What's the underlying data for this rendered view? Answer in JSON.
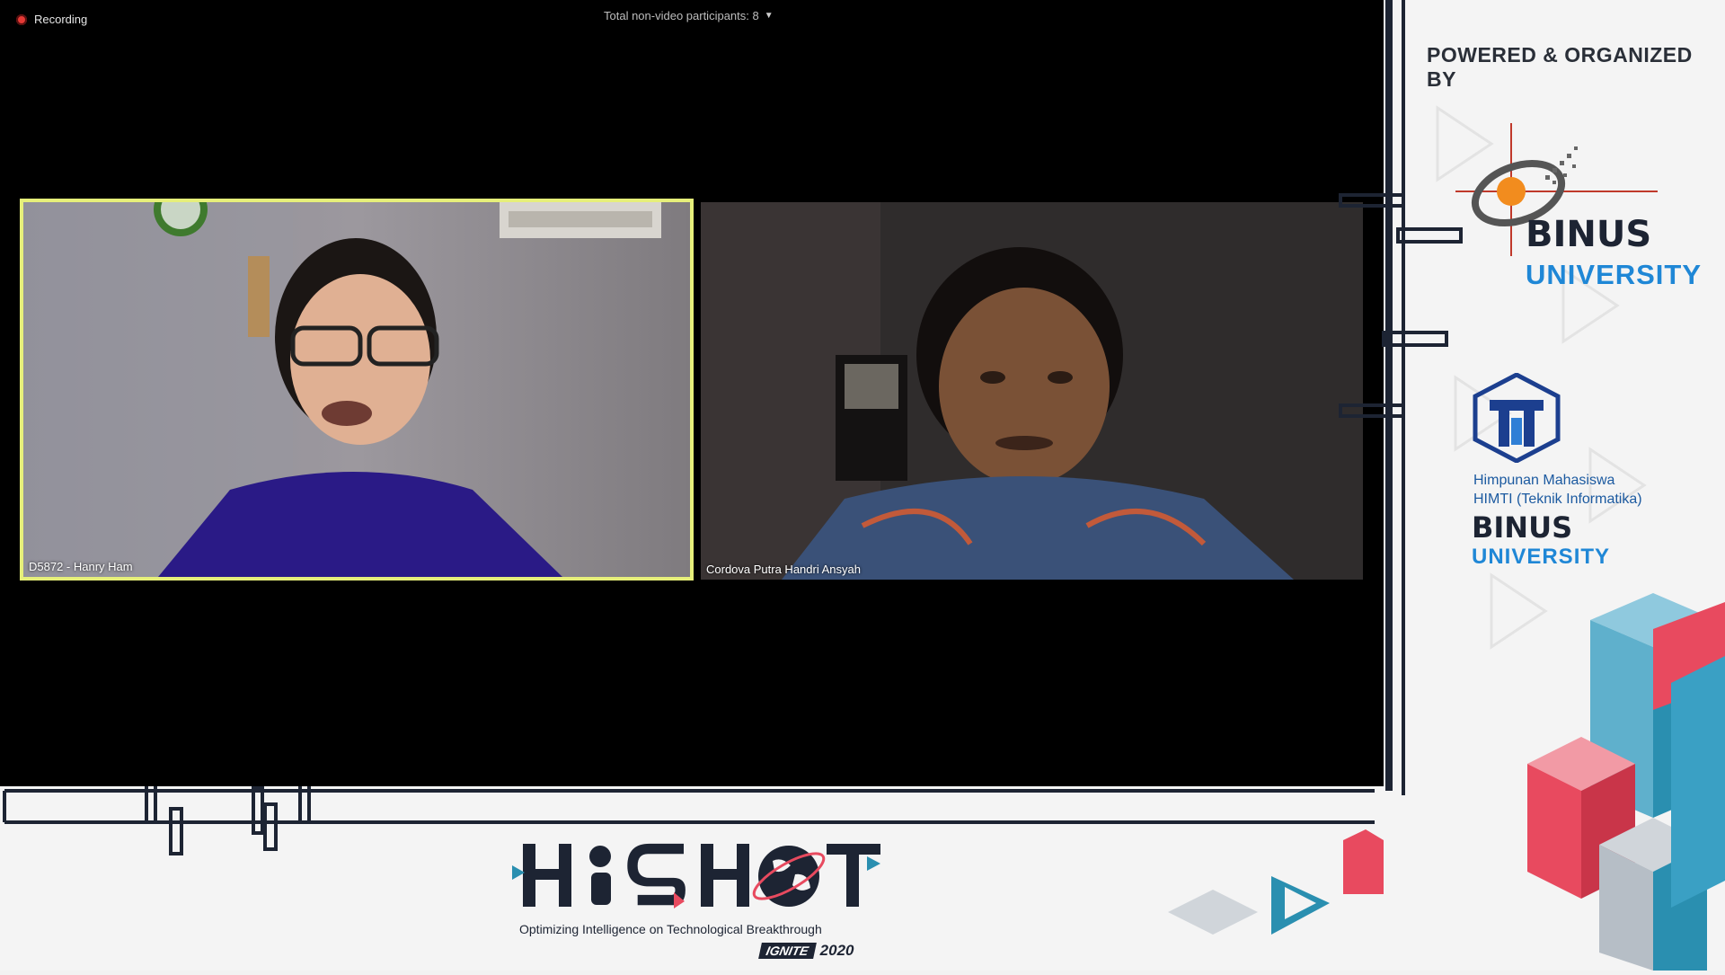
{
  "meeting": {
    "recording_label": "Recording",
    "participants_label": "Total non-video participants: 8",
    "colors": {
      "active_speaker_border": "#e6ef7a",
      "stage_bg": "#000000",
      "recording_dot": "#e53935"
    }
  },
  "tiles": [
    {
      "name": "D5872 - Hanry Ham",
      "active": true
    },
    {
      "name": "Cordova Putra Handri Ansyah",
      "active": false
    }
  ],
  "sponsors": {
    "header": "POWERED & ORGANIZED BY",
    "binus": {
      "line1": "BINUS",
      "line2": "UNIVERSITY"
    },
    "himti": {
      "line1": "Himpunan Mahasiswa",
      "line2": "HIMTI (Teknik Informatika)",
      "line3": "BINUS",
      "line4": "UNIVERSITY"
    },
    "colors": {
      "navy": "#1d2433",
      "blue": "#1f87d6",
      "accent_red": "#e84a5f",
      "accent_teal": "#2a8fb0"
    }
  },
  "event": {
    "title": "HISHOT",
    "tagline": "Optimizing Intelligence on Technological Breakthrough",
    "ignite_badge": "IGNITE",
    "year": "2020"
  }
}
